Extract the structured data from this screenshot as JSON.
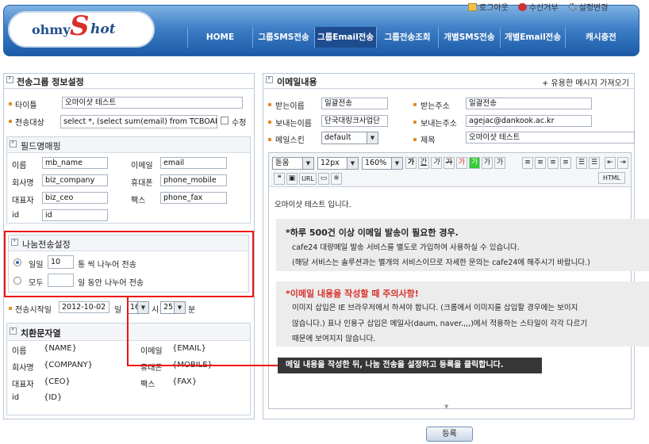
{
  "header": {
    "logo_ohmy": "ohmy",
    "logo_s": "S",
    "logo_shot": "hot",
    "top_links": [
      "로그아웃",
      "수신거부",
      "설정변경"
    ],
    "nav": [
      "HOME",
      "그룹SMS전송",
      "그룹Email전송",
      "그룹전송조회",
      "개별SMS전송",
      "개별Email전송",
      "캐시충전"
    ],
    "active_nav": "그룹Email전송"
  },
  "left": {
    "title": "전송그룹 정보설정",
    "title_label": "타이틀",
    "title_value": "오마이샷 테스트",
    "target_label": "전송대상",
    "target_value": "select *, (select sum(email) from TCBOAI",
    "edit_label": "수정",
    "fieldmap": {
      "title": "필드명매핑",
      "rows": [
        {
          "l1": "이름",
          "v1": "mb_name",
          "l2": "이메일",
          "v2": "email"
        },
        {
          "l1": "회사명",
          "v1": "biz_company",
          "l2": "휴대폰",
          "v2": "phone_mobile"
        },
        {
          "l1": "대표자",
          "v1": "biz_ceo",
          "l2": "팩스",
          "v2": "phone_fax"
        },
        {
          "l1": "id",
          "v1": "id",
          "l2": "",
          "v2": ""
        }
      ]
    },
    "split": {
      "title": "나눔전송설정",
      "opt1_label": "일일",
      "opt1_value": "10",
      "opt1_suffix": "통 씩 나누어 전송",
      "opt2_label": "모두",
      "opt2_value": "",
      "opt2_suffix": "일 동안 나누어 전송"
    },
    "start": {
      "label": "전송시작일",
      "date": "2012-10-02",
      "day_unit": "일",
      "hour": "16",
      "hour_unit": "시",
      "minute": "25",
      "minute_unit": "분"
    },
    "subst": {
      "title": "치환문자열",
      "rows": [
        {
          "l1": "이름",
          "v1": "{NAME}",
          "l2": "이메일",
          "v2": "{EMAIL}"
        },
        {
          "l1": "회사명",
          "v1": "{COMPANY}",
          "l2": "휴대폰",
          "v2": "{MOBILE}"
        },
        {
          "l1": "대표자",
          "v1": "{CEO}",
          "l2": "팩스",
          "v2": "{FAX}"
        },
        {
          "l1": "id",
          "v1": "{ID}",
          "l2": "",
          "v2": ""
        }
      ]
    }
  },
  "right": {
    "title": "이메일내용",
    "import_link": "+ 유용한 메시지 가져오기",
    "recv_name_label": "받는이름",
    "recv_name": "일괄전송",
    "recv_addr_label": "받는주소",
    "recv_addr": "일괄전송",
    "send_name_label": "보내는이름",
    "send_name": "단국대링크사업단",
    "send_addr_label": "보내는주소",
    "send_addr": "agejac@dankook.ac.kr",
    "skin_label": "메일스킨",
    "skin_value": "default",
    "subject_label": "제목",
    "subject_value": "오마이샷 테스트",
    "toolbar": {
      "font": "돋움",
      "size": "12px",
      "lineheight": "160%",
      "url_label": "URL",
      "html_label": "HTML",
      "style_buttons": [
        "가",
        "간",
        "가",
        "가",
        "가",
        "가",
        "가",
        "가"
      ]
    },
    "body": {
      "intro": "오마이샷 테스트 입니다.",
      "notice1_title": "*하루 500건 이상 이메일 발송이 필요한 경우.",
      "notice1_line1": "cafe24 대량메일 발송 서비스를 별도로 가입하여 사용하실 수 있습니다.",
      "notice1_line2": "(해당 서비스는 솔루션과는 별개의 서비스이므로 자세한 문의는 cafe24에 해주시기 바랍니다.)",
      "notice2_title": "*이메일 내용을 작성할 때 주의사항!",
      "notice2_line1": "이미지 삽입은 IE 브라우저에서 하셔야 합니다. (크롬에서 이미지를 삽입할 경우에는 보이지",
      "notice2_line2": "않습니다.) 표나 인용구 삽입은 메일사(daum, naver.,,,)에서 적용하는 스타일이 각각 다르기",
      "notice2_line3": "때문에 보여지지 않습니다."
    }
  },
  "callout": "메일 내용을 작성한 뒤, 나눔 전송을 설정하고 등록을 클릭합니다.",
  "submit_label": "등록",
  "colors": {
    "accent_red": "#d8302a",
    "nav_blue": "#2b66b0",
    "bullet_orange": "#e08a1e"
  }
}
